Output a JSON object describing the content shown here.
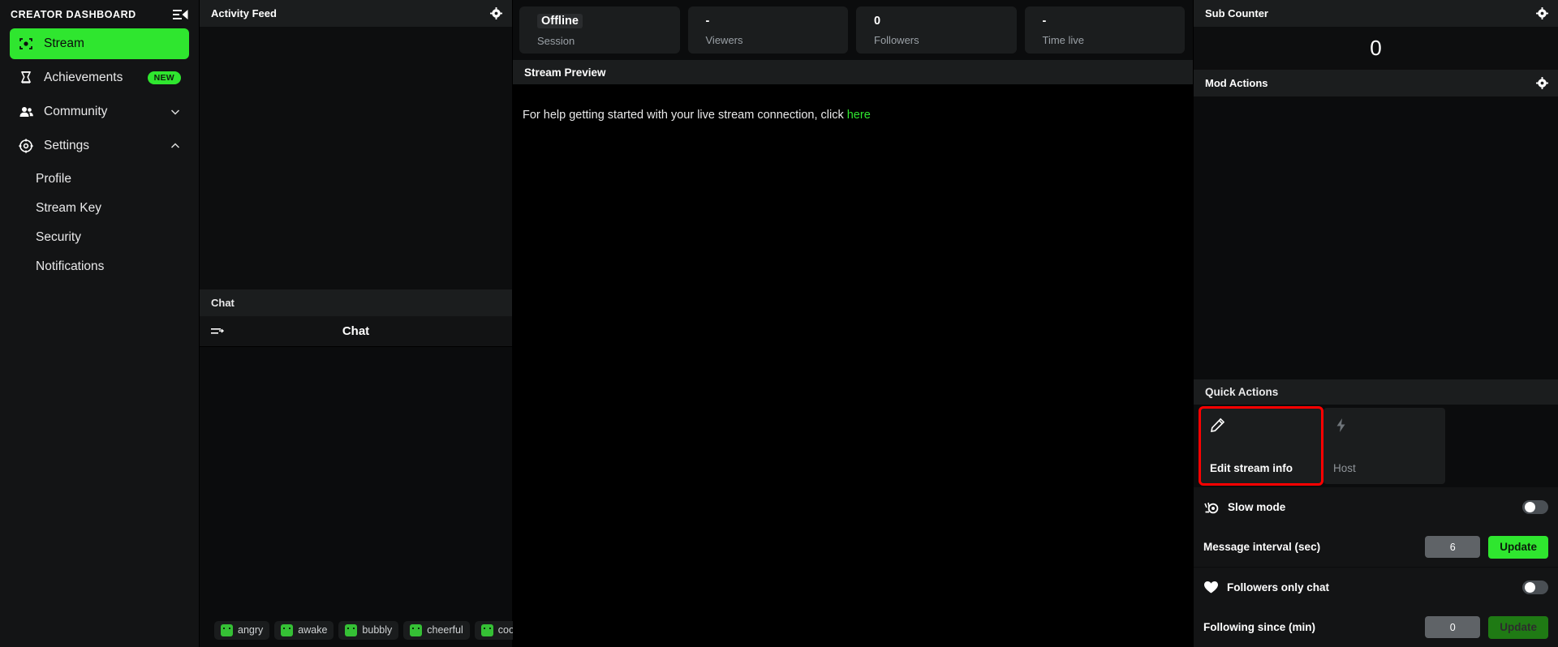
{
  "sidebar": {
    "title": "CREATOR DASHBOARD",
    "collapse_icon": "collapse-panel-icon",
    "items": [
      {
        "label": "Stream",
        "icon": "stream-target-icon",
        "active": true
      },
      {
        "label": "Achievements",
        "icon": "trophy-icon",
        "badge": "NEW"
      },
      {
        "label": "Community",
        "icon": "people-icon",
        "chevron": "down"
      },
      {
        "label": "Settings",
        "icon": "gear-icon",
        "chevron": "up"
      }
    ],
    "sub_items": [
      {
        "label": "Profile"
      },
      {
        "label": "Stream Key"
      },
      {
        "label": "Security"
      },
      {
        "label": "Notifications"
      }
    ]
  },
  "activity_feed": {
    "title": "Activity Feed",
    "settings_icon": "gear-icon"
  },
  "chat_panel": {
    "header": "Chat",
    "bar_title": "Chat",
    "menu_icon": "chat-menu-icon",
    "emotes": [
      {
        "label": "angry",
        "icon": "emote-angry-icon"
      },
      {
        "label": "awake",
        "icon": "emote-awake-icon"
      },
      {
        "label": "bubbly",
        "icon": "emote-bubbly-icon"
      },
      {
        "label": "cheerful",
        "icon": "emote-cheerful-icon"
      },
      {
        "label": "cool",
        "icon": "emote-cool-icon"
      }
    ]
  },
  "stats": [
    {
      "value": "Offline",
      "label": "Session",
      "badge": true
    },
    {
      "value": "-",
      "label": "Viewers",
      "badge": false
    },
    {
      "value": "0",
      "label": "Followers",
      "badge": false
    },
    {
      "value": "-",
      "label": "Time live",
      "badge": false
    }
  ],
  "stream_preview": {
    "title": "Stream Preview",
    "help_text_prefix": "For help getting started with your live stream connection, click ",
    "help_link": "here"
  },
  "sub_counter": {
    "title": "Sub Counter",
    "settings_icon": "gear-icon",
    "value": "0"
  },
  "mod_actions": {
    "title": "Mod Actions",
    "settings_icon": "gear-icon"
  },
  "quick_actions": {
    "title": "Quick Actions",
    "cards": [
      {
        "label": "Edit stream info",
        "icon": "pencil-icon",
        "highlighted": true
      },
      {
        "label": "Host",
        "icon": "lightning-bolt-icon",
        "highlighted": false
      }
    ]
  },
  "mod_settings": {
    "slow_mode": {
      "label": "Slow mode",
      "icon": "snail-icon",
      "toggle_on": false,
      "interval_label": "Message interval (sec)",
      "interval_value": "6",
      "update_label": "Update",
      "update_enabled": true
    },
    "followers_only": {
      "label": "Followers only chat",
      "icon": "heart-icon",
      "toggle_on": false,
      "since_label": "Following since (min)",
      "since_value": "0",
      "update_label": "Update",
      "update_enabled": false
    }
  },
  "colors": {
    "accent_green": "#2fe62f",
    "highlight_red": "#ff0000",
    "panel_bg": "#1b1d1e",
    "page_bg": "#0b0c0d"
  }
}
